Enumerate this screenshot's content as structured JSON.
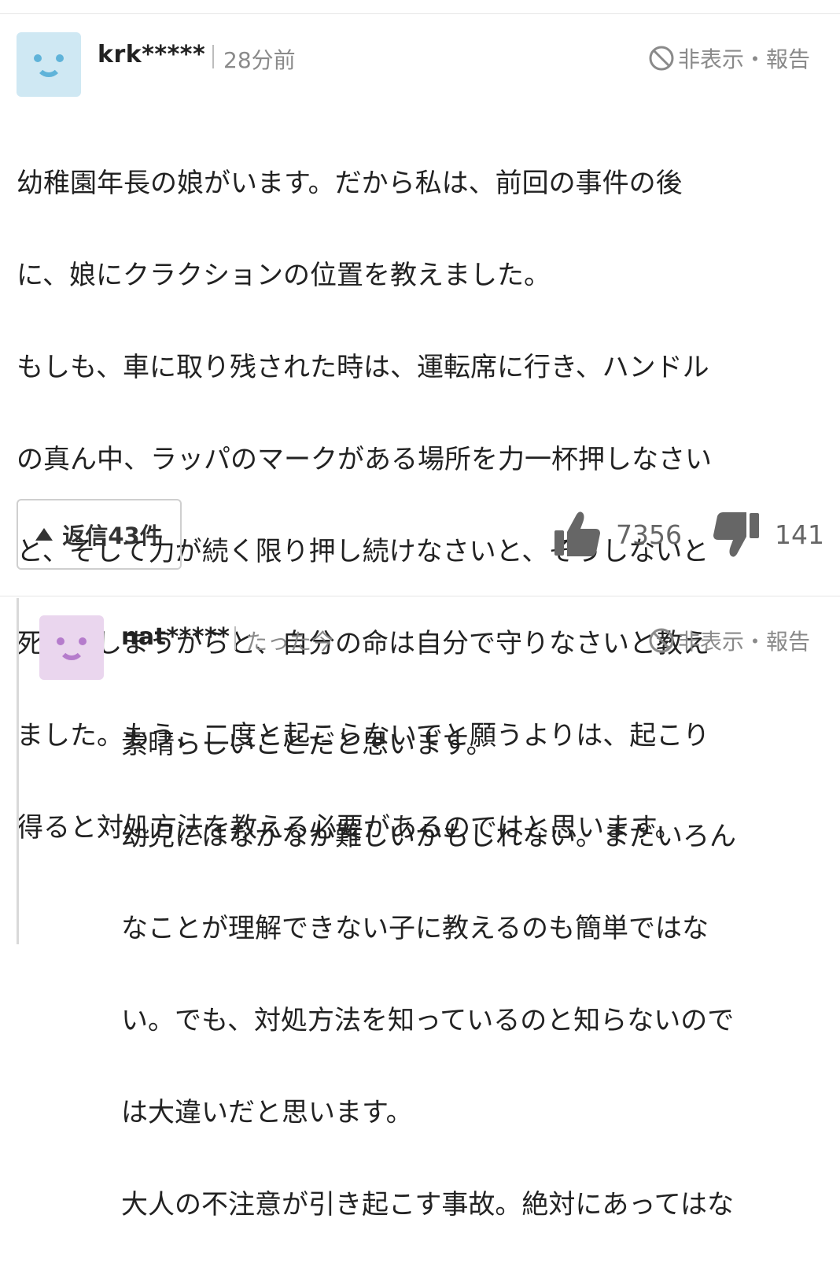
{
  "comment": {
    "username": "krk*****",
    "time": "28分前",
    "hide_report": "非表示・報告",
    "body_lines": [
      "幼稚園年長の娘がいます。だから私は、前回の事件の後",
      "に、娘にクラクションの位置を教えました。",
      "もしも、車に取り残された時は、運転席に行き、ハンドル",
      "の真ん中、ラッパのマークがある場所を力一杯押しなさい",
      "と、そして力が続く限り押し続けなさいと、そうしないと",
      "死んでしまうからと、自分の命は自分で守りなさいと教え",
      "ました。もう、二度と起こらないでと願うよりは、起こり",
      "得ると対処方法を教える必要があるのではと思います。"
    ],
    "reply_button": "返信43件",
    "likes": "7356",
    "dislikes": "141",
    "avatar_color": "#cfe8f3"
  },
  "reply": {
    "username": "nat*****",
    "time": "たった今",
    "hide_report": "非表示・報告",
    "body_lines": [
      "素晴らしいことだと思います。",
      "幼児にはなかなか難しいかもしれない。まだいろん",
      "なことが理解できない子に教えるのも簡単ではな",
      "い。でも、対処方法を知っているのと知らないので",
      "は大違いだと思います。",
      "大人の不注意が引き起こす事故。絶対にあってはな"
    ],
    "avatar_color": "#ead6ee"
  },
  "icons": {
    "hide": "prohibited-icon",
    "like": "thumbs-up-icon",
    "dislike": "thumbs-down-icon",
    "reply_toggle": "triangle-up-icon"
  }
}
